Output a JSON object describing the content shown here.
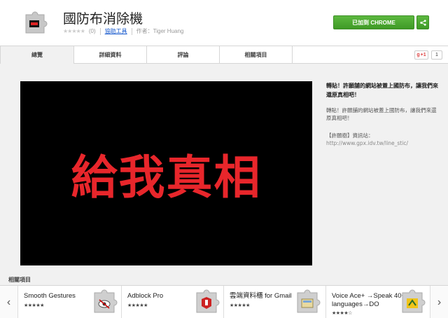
{
  "header": {
    "title": "國防布消除機",
    "rating_count": "(0)",
    "category": "協助工具",
    "author": "作者：Tiger Huang",
    "add_button": "已加到 CHROME"
  },
  "tabs": [
    {
      "label": "總覽"
    },
    {
      "label": "詳細資料"
    },
    {
      "label": "評論"
    },
    {
      "label": "相關項目"
    }
  ],
  "gplus": {
    "label": "+1",
    "count": "1"
  },
  "screenshot": {
    "text": "給我真相"
  },
  "description": {
    "heading": "轉貼！許願舗的網站被蓋上國防布，讓我們來還原真相吧！",
    "body": "轉貼！許願舗的網站被蓋上國防布，讓我們來還原真相吧！",
    "source_label": "【許願樹】資訊站：",
    "source_url": "http://www.gpx.idv.tw/line_stic/"
  },
  "related": {
    "title": "相關項目",
    "items": [
      {
        "name": "Smooth Gestures",
        "stars": "★★★★★"
      },
      {
        "name": "Adblock Pro",
        "stars": "★★★★★"
      },
      {
        "name": "雲端資料櫃 for Gmail",
        "stars": "★★★★★"
      },
      {
        "name": "Voice Ace+ →Speak 40+ languages→DO",
        "stars": "★★★★☆"
      }
    ]
  },
  "colors": {
    "accent_green": "#4aa531",
    "screenshot_text": "#e8262b",
    "link_blue": "#1155cc"
  }
}
